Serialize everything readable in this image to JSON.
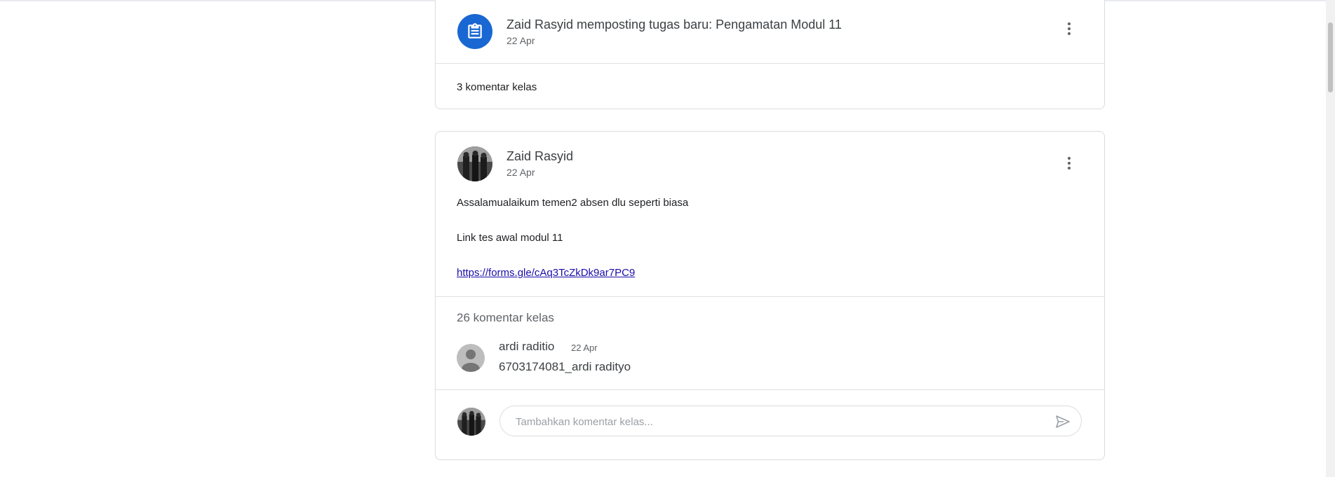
{
  "colors": {
    "accent": "#1967d2",
    "link": "#1a0dab",
    "border": "#dadce0",
    "muted": "#5f6368"
  },
  "assignment_post": {
    "icon": "assignment-icon",
    "title": "Zaid Rasyid memposting tugas baru: Pengamatan Modul 11",
    "date": "22 Apr",
    "menu_icon": "more-vert-icon",
    "comment_count": "3 komentar kelas"
  },
  "announcement_post": {
    "author": "Zaid Rasyid",
    "date": "22 Apr",
    "menu_icon": "more-vert-icon",
    "body_line_1": "Assalamualaikum temen2 absen dlu seperti biasa",
    "body_line_2": "Link tes awal modul 11",
    "link": "https://forms.gle/cAq3TcZkDk9ar7PC9",
    "comments_header": "26 komentar kelas",
    "comment": {
      "author": "ardi raditio",
      "date": "22 Apr",
      "text": "6703174081_ardi radityo"
    },
    "reply": {
      "placeholder": "Tambahkan komentar kelas...",
      "send_icon": "send-icon"
    }
  }
}
